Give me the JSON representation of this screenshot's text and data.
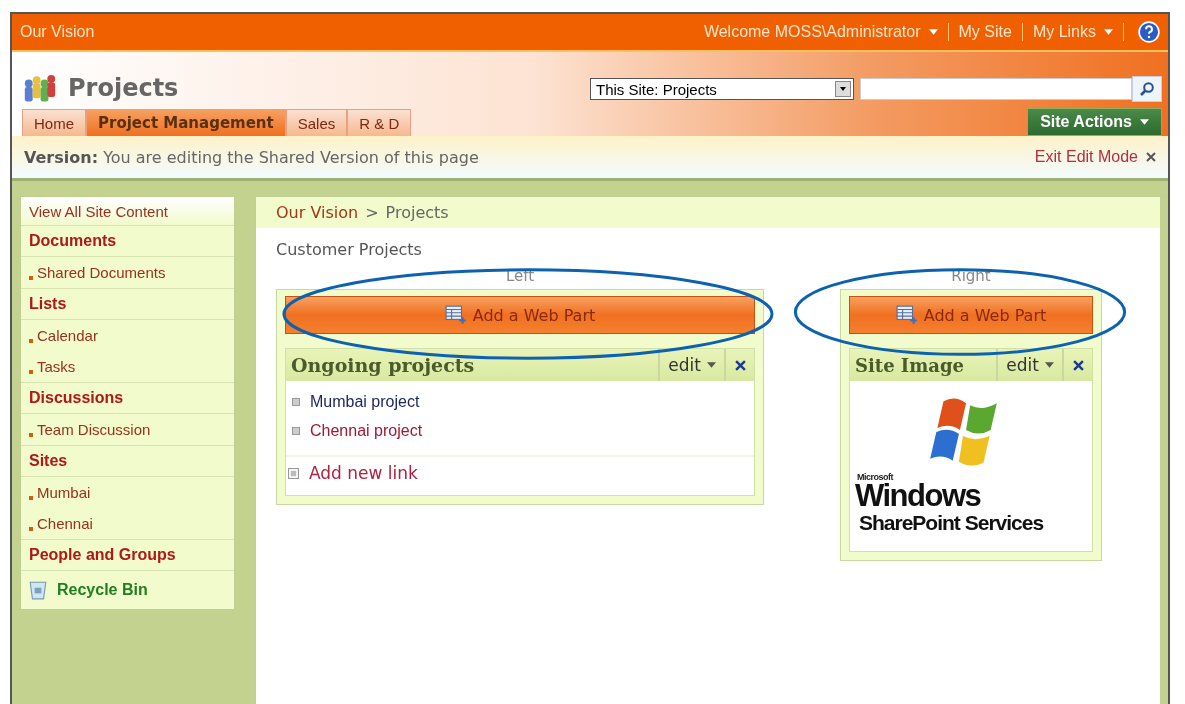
{
  "top_bar": {
    "site": "Our Vision",
    "welcome": "Welcome MOSS\\Administrator",
    "links": [
      {
        "text": "My Site",
        "menu": false
      },
      {
        "text": "My Links",
        "menu": true
      }
    ]
  },
  "header": {
    "title": "Projects",
    "scope": "This Site: Projects",
    "site_actions": "Site Actions"
  },
  "tabs": [
    {
      "label": "Home",
      "selected": false
    },
    {
      "label": "Project Management",
      "selected": true
    },
    {
      "label": "Sales",
      "selected": false
    },
    {
      "label": "R & D",
      "selected": false
    }
  ],
  "version_bar": {
    "label": "Version:",
    "text": "You are editing the Shared Version of this page",
    "exit": "Exit Edit Mode"
  },
  "sidebar": {
    "items": [
      {
        "kind": "link",
        "text": "View All Site Content"
      },
      {
        "kind": "heading",
        "text": "Documents"
      },
      {
        "kind": "item",
        "text": "Shared Documents"
      },
      {
        "kind": "heading",
        "text": "Lists"
      },
      {
        "kind": "item",
        "text": "Calendar"
      },
      {
        "kind": "item",
        "text": "Tasks"
      },
      {
        "kind": "heading",
        "text": "Discussions"
      },
      {
        "kind": "item",
        "text": "Team Discussion"
      },
      {
        "kind": "heading",
        "text": "Sites"
      },
      {
        "kind": "item",
        "text": "Mumbai"
      },
      {
        "kind": "item",
        "text": "Chennai"
      },
      {
        "kind": "heading",
        "text": "People and Groups"
      },
      {
        "kind": "recycle",
        "text": "Recycle Bin"
      }
    ]
  },
  "breadcrumb": {
    "parent": "Our Vision",
    "separator": ">",
    "current": "Projects"
  },
  "page_title": "Customer Projects",
  "zones": [
    {
      "label": "Left",
      "add_button": "Add a Web Part",
      "highlighted": true,
      "parts": [
        {
          "kind": "links",
          "title": "Ongoing projects",
          "edit": "edit",
          "links": [
            {
              "text": "Mumbai project",
              "visited": false
            },
            {
              "text": "Chennai project",
              "visited": true
            }
          ],
          "add_link": "Add new link"
        }
      ]
    },
    {
      "label": "Right",
      "add_button": "Add a Web Part",
      "highlighted": true,
      "parts": [
        {
          "kind": "image",
          "title": "Site Image",
          "edit": "edit",
          "image": {
            "brand": "Microsoft",
            "product": "Windows",
            "subtitle": "SharePoint Services"
          }
        }
      ]
    }
  ]
}
